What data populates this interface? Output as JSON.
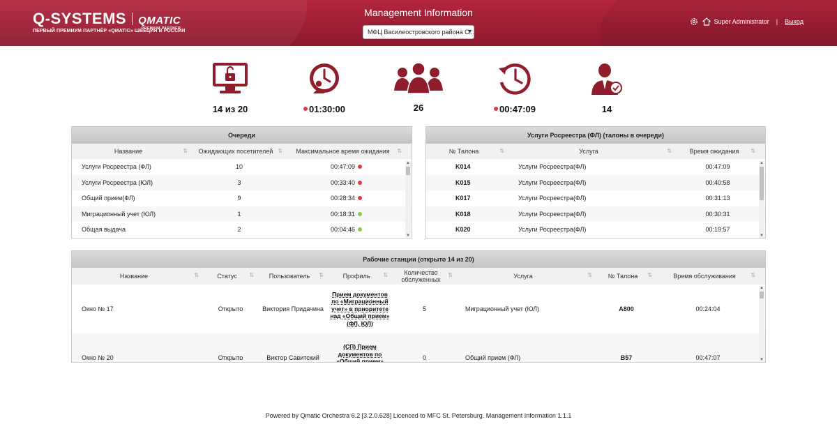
{
  "header": {
    "brand": "Q-SYSTEMS",
    "partner": "QMATIC",
    "partner_sub": "PREMIUM PARTNER",
    "tagline": "ПЕРВЫЙ ПРЕМИУМ ПАРТНЁР «QMATIC» ШВЕЦИЯ В РОССИИ",
    "app_title": "Management Information",
    "site_selected": "МФЦ Василеостровского района С...",
    "user_name": "Super Administrator",
    "separator": "|",
    "logout": "Выход"
  },
  "kpis": [
    {
      "icon": "unlocked-monitor-icon",
      "value": "14 из 20"
    },
    {
      "icon": "clock-person-icon",
      "value": "01:30:00"
    },
    {
      "icon": "people-group-icon",
      "value": "26"
    },
    {
      "icon": "clock-refresh-icon",
      "value": "00:47:09"
    },
    {
      "icon": "user-check-icon",
      "value": "14"
    }
  ],
  "queues": {
    "title": "Очереди",
    "columns": [
      "Название",
      "Ожидающих посетителей",
      "Максимальное время ожидания"
    ],
    "rows": [
      {
        "name": "Услуги Росреестра (ФЛ)",
        "waiting": "10",
        "max_wait": "00:47:09",
        "status": "red"
      },
      {
        "name": "Услуги Росреестра (ЮЛ)",
        "waiting": "3",
        "max_wait": "00:33:40",
        "status": "red"
      },
      {
        "name": "Общий прием(ФЛ)",
        "waiting": "9",
        "max_wait": "00:28:34",
        "status": "red"
      },
      {
        "name": "Миграционный учет (ЮЛ)",
        "waiting": "1",
        "max_wait": "00:18:31",
        "status": "green"
      },
      {
        "name": "Общая выдача",
        "waiting": "2",
        "max_wait": "00:04:46",
        "status": "green"
      }
    ]
  },
  "tickets": {
    "title": "Услуги Росреестра (ФЛ) (талоны в очереди)",
    "columns": [
      "№ Талона",
      "Услуга",
      "Время ожидания"
    ],
    "rows": [
      {
        "ticket": "K014",
        "service": "Услуги Росреестра(ФЛ)",
        "wait": "00:47:09"
      },
      {
        "ticket": "K015",
        "service": "Услуги Росреестра(ФЛ)",
        "wait": "00:40:58"
      },
      {
        "ticket": "K017",
        "service": "Услуги Росреестра(ФЛ)",
        "wait": "00:31:13"
      },
      {
        "ticket": "K018",
        "service": "Услуги Росреестра(ФЛ)",
        "wait": "00:30:31"
      },
      {
        "ticket": "K020",
        "service": "Услуги Росреестра(ФЛ)",
        "wait": "00:19:57"
      }
    ]
  },
  "workstations": {
    "title": "Рабочие станции (открыто 14 из 20)",
    "columns": [
      "Название",
      "Статус",
      "Пользователь",
      "Профиль",
      "Количество обслуженных",
      "Услуга",
      "№ Талона",
      "Время обслуживания"
    ],
    "rows": [
      {
        "name": "Окно № 17",
        "status": "Открыто",
        "user": "Виктория Придачина",
        "profile": "Прием документов по «Миграционный учет» в приоритете над «Общий прием» (ФЛ, ЮЛ)",
        "served": "5",
        "service": "Миграционный учет (ЮЛ)",
        "ticket": "A800",
        "time": "00:24:04"
      },
      {
        "name": "Окно № 20",
        "status": "Открыто",
        "user": "Виктор Савитский",
        "profile": "(СП) Прием документов по «Общий прием» (ФЛ) в",
        "served": "0",
        "service": "Общий прием (ФЛ)",
        "ticket": "B57",
        "time": "00:47:07"
      }
    ]
  },
  "footer": "Powered by Qmatic Orchestra 6.2 [3.2.0.628] Licenced to MFC St. Petersburg. Management Information 1.1.1",
  "colors": {
    "brand": "#9c1e33",
    "icon": "#8f1d2c",
    "alert": "#e03c3c",
    "ok": "#8fc64f"
  }
}
